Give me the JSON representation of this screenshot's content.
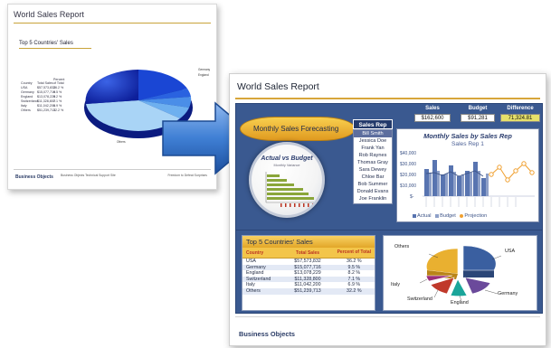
{
  "back_report": {
    "title": "World Sales Report",
    "chart_title": "Top 5 Countries' Sales",
    "table_headers": [
      "Country",
      "Total Sales",
      "Percent of Total"
    ],
    "footer_logo": "Business Objects",
    "footer_text": "Business Objects Technical Support Site",
    "footer_right": "Freedom to Defeat Surprises"
  },
  "front_report": {
    "title": "World Sales Report",
    "banner": "Monthly Sales Forecasting",
    "summary": {
      "sales_label": "Sales",
      "sales_value": "$162,600",
      "budget_label": "Budget",
      "budget_value": "$91,281",
      "difference_label": "Difference",
      "difference_value": "71,324.81"
    },
    "lens": {
      "title": "Actual vs Budget",
      "subtitle": "Monthly Variance"
    },
    "sales_rep": {
      "title": "Sales Rep",
      "items": [
        "Bill Smith",
        "Jessica Doe",
        "Frank Yan",
        "Rob Raynes",
        "Thomas Gray",
        "Sara Dewey",
        "Chloe Bar",
        "Bob Summer",
        "Donald Evans",
        "Joe Franklin"
      ],
      "selected_index": 0
    },
    "monthly_chart": {
      "title": "Monthly Sales by Sales Rep",
      "subtitle": "Sales Rep 1",
      "y_ticks": [
        "$40,000",
        "$30,000",
        "$20,000",
        "$10,000",
        "$-"
      ],
      "legend": [
        "Actual",
        "Budget",
        "Projection"
      ]
    },
    "top5": {
      "title": "Top 5 Countries' Sales",
      "headers": {
        "country": "Country",
        "total": "Total Sales",
        "percent": "Percent of Total"
      },
      "rows": [
        {
          "country": "USA",
          "total": "$57,573,832",
          "percent": "36.2 %"
        },
        {
          "country": "Germany",
          "total": "$15,077,716",
          "percent": "9.5 %"
        },
        {
          "country": "England",
          "total": "$13,078,229",
          "percent": "8.2 %"
        },
        {
          "country": "Switzerland",
          "total": "$11,328,800",
          "percent": "7.1 %"
        },
        {
          "country": "Italy",
          "total": "$11,042,200",
          "percent": "6.9 %"
        },
        {
          "country": "Others",
          "total": "$51,239,713",
          "percent": "32.2 %"
        }
      ],
      "pie_labels": [
        "Others",
        "USA",
        "Germany",
        "England",
        "Switzerland",
        "Italy"
      ]
    },
    "footer_logo": "Business Objects"
  },
  "colors": {
    "dashboard_blue": "#3a5990",
    "gold": "#e9b030",
    "actual": "#5874b0",
    "budget": "#8ea0c8",
    "projection": "#f0a030"
  }
}
